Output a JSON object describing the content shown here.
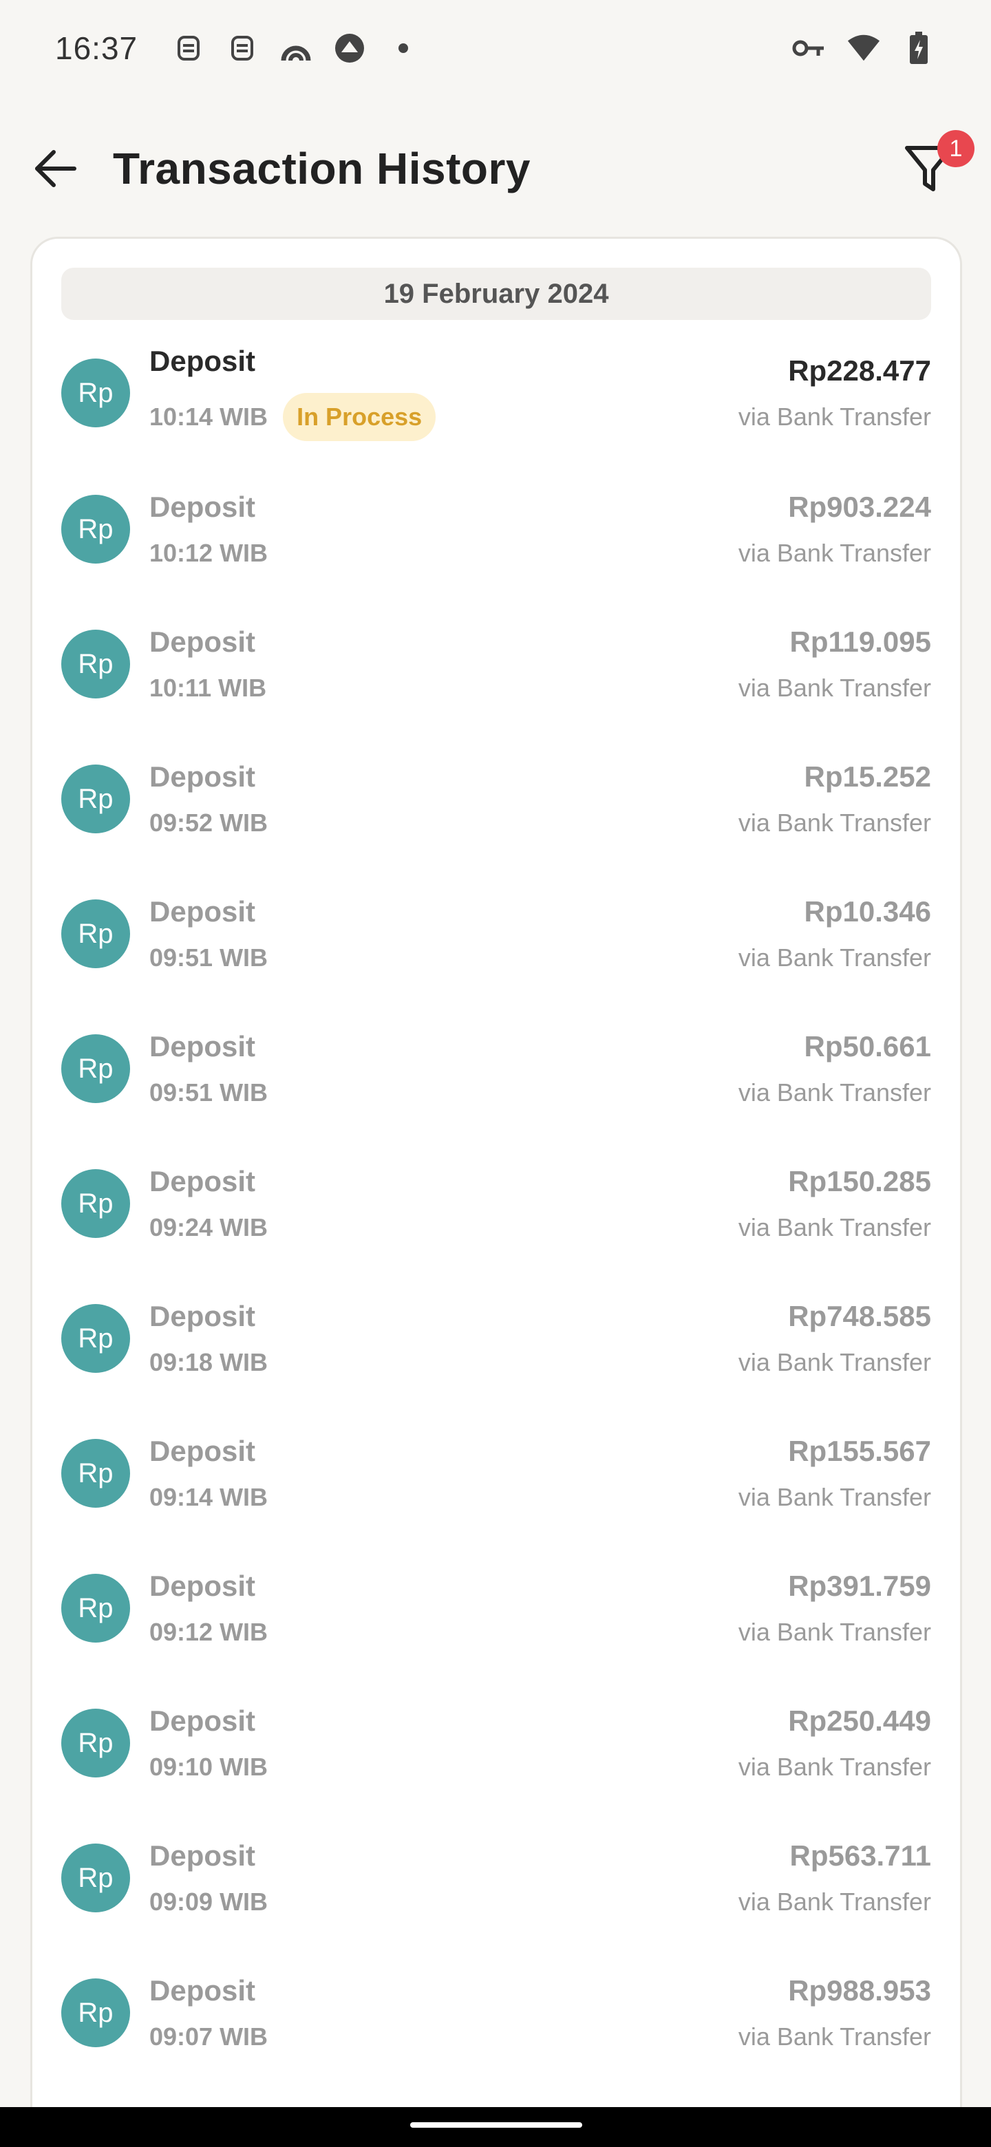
{
  "status_bar": {
    "time": "16:37",
    "left_icons": [
      "notification-icon",
      "notification-icon",
      "app-icon",
      "app-icon",
      "dot-icon"
    ],
    "right_icons": [
      "key-icon",
      "wifi-icon",
      "battery-charging-icon"
    ]
  },
  "header": {
    "title": "Transaction History",
    "filter_badge": "1"
  },
  "date_header": "19 February 2024",
  "colors": {
    "avatar": "#4da4a4",
    "badge": "#e8474f",
    "pending_bg": "#fdf0cd",
    "pending_text": "#d8a02a"
  },
  "transactions": [
    {
      "avatar": "Rp",
      "type": "Deposit",
      "time": "10:14 WIB",
      "status": "In Process",
      "amount": "Rp228.477",
      "method": "via Bank Transfer"
    },
    {
      "avatar": "Rp",
      "type": "Deposit",
      "time": "10:12 WIB",
      "amount": "Rp903.224",
      "method": "via Bank Transfer"
    },
    {
      "avatar": "Rp",
      "type": "Deposit",
      "time": "10:11 WIB",
      "amount": "Rp119.095",
      "method": "via Bank Transfer"
    },
    {
      "avatar": "Rp",
      "type": "Deposit",
      "time": "09:52 WIB",
      "amount": "Rp15.252",
      "method": "via Bank Transfer"
    },
    {
      "avatar": "Rp",
      "type": "Deposit",
      "time": "09:51 WIB",
      "amount": "Rp10.346",
      "method": "via Bank Transfer"
    },
    {
      "avatar": "Rp",
      "type": "Deposit",
      "time": "09:51 WIB",
      "amount": "Rp50.661",
      "method": "via Bank Transfer"
    },
    {
      "avatar": "Rp",
      "type": "Deposit",
      "time": "09:24 WIB",
      "amount": "Rp150.285",
      "method": "via Bank Transfer"
    },
    {
      "avatar": "Rp",
      "type": "Deposit",
      "time": "09:18 WIB",
      "amount": "Rp748.585",
      "method": "via Bank Transfer"
    },
    {
      "avatar": "Rp",
      "type": "Deposit",
      "time": "09:14 WIB",
      "amount": "Rp155.567",
      "method": "via Bank Transfer"
    },
    {
      "avatar": "Rp",
      "type": "Deposit",
      "time": "09:12 WIB",
      "amount": "Rp391.759",
      "method": "via Bank Transfer"
    },
    {
      "avatar": "Rp",
      "type": "Deposit",
      "time": "09:10 WIB",
      "amount": "Rp250.449",
      "method": "via Bank Transfer"
    },
    {
      "avatar": "Rp",
      "type": "Deposit",
      "time": "09:09 WIB",
      "amount": "Rp563.711",
      "method": "via Bank Transfer"
    },
    {
      "avatar": "Rp",
      "type": "Deposit",
      "time": "09:07 WIB",
      "amount": "Rp988.953",
      "method": "via Bank Transfer"
    }
  ]
}
